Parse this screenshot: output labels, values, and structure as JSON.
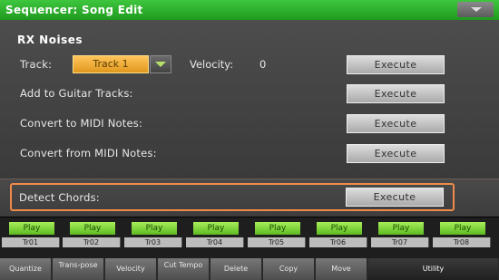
{
  "title": "Sequencer: Song Edit",
  "section": "RX Noises",
  "track_label": "Track:",
  "track_value": "Track 1",
  "velocity_label": "Velocity:",
  "velocity_value": "0",
  "execute_label": "Execute",
  "rows": [
    "Add to Guitar Tracks:",
    "Convert to MIDI Notes:",
    "Convert from MIDI Notes:",
    "Detect Chords:"
  ],
  "tracks": [
    {
      "play": "Play",
      "name": "Tr01"
    },
    {
      "play": "Play",
      "name": "Tr02"
    },
    {
      "play": "Play",
      "name": "Tr03"
    },
    {
      "play": "Play",
      "name": "Tr04"
    },
    {
      "play": "Play",
      "name": "Tr05"
    },
    {
      "play": "Play",
      "name": "Tr06"
    },
    {
      "play": "Play",
      "name": "Tr07"
    },
    {
      "play": "Play",
      "name": "Tr08"
    }
  ],
  "tabs": [
    "Quantize",
    "Trans-pose",
    "Velocity",
    "Cut Tempo",
    "Delete",
    "Copy",
    "Move",
    "Utility"
  ],
  "active_tab": "Utility",
  "colors": {
    "titlebar": "#2fb52f",
    "track_select": "#f0ac35",
    "highlight": "#f08a4a",
    "play": "#7cd23a"
  }
}
